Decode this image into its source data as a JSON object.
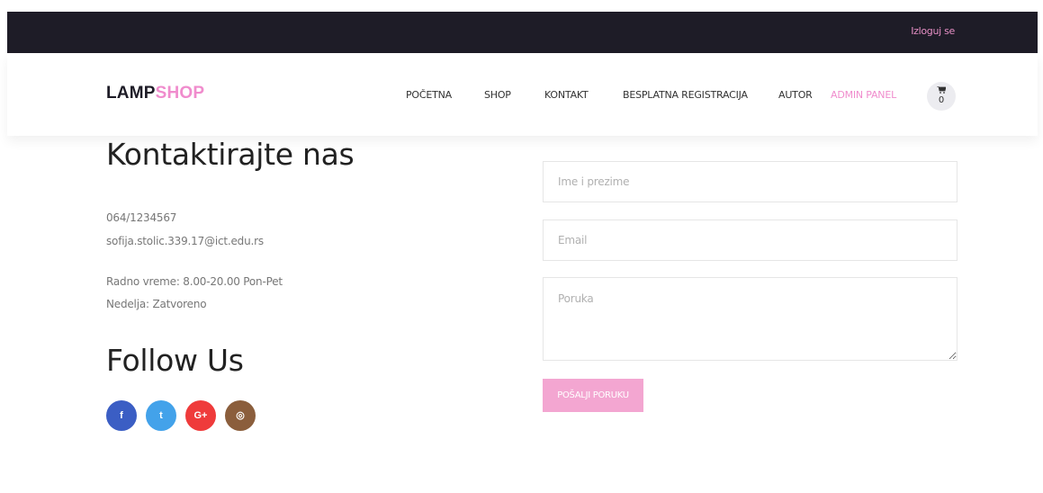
{
  "topbar": {
    "logout_label": "Izloguj se"
  },
  "header": {
    "logo_part1": "LAMP",
    "logo_part2": "SHOP",
    "nav": [
      "POČETNA",
      "SHOP",
      "KONTAKT",
      "BESPLATNA REGISTRACIJA",
      "AUTOR",
      "ADMIN PANEL"
    ],
    "cart_count": "0"
  },
  "contact": {
    "title": "Kontaktirajte nas",
    "phone": "064/1234567",
    "email": "sofija.stolic.339.17@ict.edu.rs",
    "hours_weekdays": "Radno vreme: 8.00-20.00 Pon-Pet",
    "hours_sunday": "Nedelja: Zatvoreno",
    "follow_title": "Follow Us",
    "social": [
      {
        "icon": "facebook-icon",
        "glyph": "f"
      },
      {
        "icon": "twitter-icon",
        "glyph": "t"
      },
      {
        "icon": "google-plus-icon",
        "glyph": "G+"
      },
      {
        "icon": "instagram-icon",
        "glyph": "◎"
      }
    ]
  },
  "form": {
    "name_placeholder": "Ime i prezime",
    "email_placeholder": "Email",
    "message_placeholder": "Poruka",
    "submit_label": "POŠALJI PORUKU"
  },
  "colors": {
    "topbar": "#1e1c27",
    "accent": "#f08ccd",
    "button": "#f3a6d1",
    "facebook": "#3b5ec4",
    "twitter": "#43a2ea",
    "google_plus": "#ef3b3b",
    "instagram": "#8b5e3c"
  }
}
